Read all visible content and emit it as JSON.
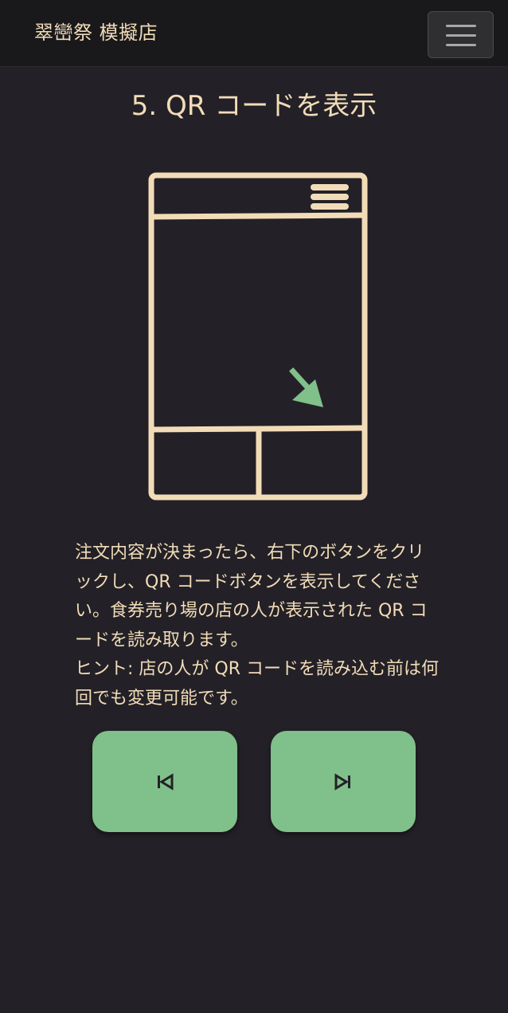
{
  "header": {
    "brand": "翠巒祭 模擬店",
    "menu_icon": "hamburger-menu-icon"
  },
  "page": {
    "title": "5. QR コードを表示"
  },
  "illustration": {
    "line_color": "#f2dcb8",
    "arrow_color": "#80c08a",
    "arrow_icon": "arrow-down-right-icon"
  },
  "description": {
    "body": "注文内容が決まったら、右下のボタンをクリックし、QR コードボタンを表示してください。食券売り場の店の人が表示された QR コードを読み取ります。",
    "hint": "ヒント: 店の人が QR コードを読み込む前は何回でも変更可能です。"
  },
  "navigation": {
    "prev_icon": "skip-previous-icon",
    "next_icon": "skip-next-icon",
    "button_color": "#80c08a"
  },
  "colors": {
    "background": "#232127",
    "navbar": "#19181b",
    "text": "#f2dcb8"
  }
}
